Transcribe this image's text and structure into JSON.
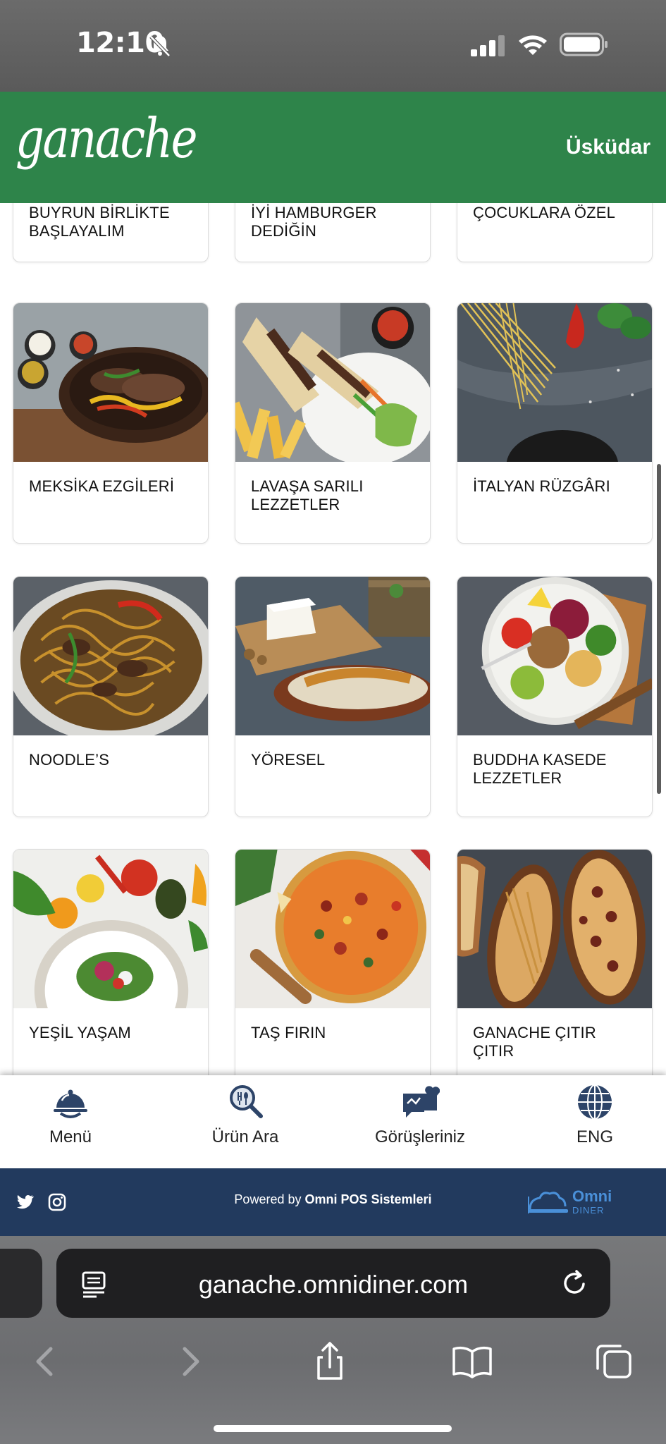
{
  "status_bar": {
    "time": "12:10"
  },
  "header": {
    "logo": "ganache",
    "branch": "Üsküdar"
  },
  "categories": [
    {
      "label": "BUYRUN BİRLİKTE\nBAŞLAYALIM"
    },
    {
      "label": "İYİ HAMBURGER\nDEDİĞİN"
    },
    {
      "label": "ÇOCUKLARA ÖZEL"
    },
    {
      "label": "MEKSİKA EZGİLERİ"
    },
    {
      "label": "LAVAŞA SARILI\nLEZZETLER"
    },
    {
      "label": "İTALYAN RÜZGÂRI"
    },
    {
      "label": "NOODLE’S"
    },
    {
      "label": "YÖRESEL"
    },
    {
      "label": "BUDDHA KASEDE\nLEZZETLER"
    },
    {
      "label": "YEŞİL YAŞAM"
    },
    {
      "label": "TAŞ FIRIN"
    },
    {
      "label": "GANACHE ÇITIR\nÇITIR"
    }
  ],
  "bottom_nav": {
    "menu": "Menü",
    "search": "Ürün Ara",
    "feedback": "Görüşleriniz",
    "language": "ENG"
  },
  "footer": {
    "powered_prefix": "Powered by",
    "powered_brand": "Omni POS Sistemleri",
    "omni_logo": "Omni",
    "omni_sub": "DINER"
  },
  "browser": {
    "url": "ganache.omnidiner.com"
  },
  "colors": {
    "header_green": "#2e844a",
    "footer_navy": "#223a5e",
    "nav_icon_navy": "#2d4468"
  },
  "icons": {
    "status": [
      "bell-slash-icon",
      "signal-icon",
      "wifi-icon",
      "battery-icon"
    ],
    "nav": [
      "cloche-icon",
      "search-icon",
      "feedback-icon",
      "globe-icon"
    ],
    "footer": [
      "twitter-icon",
      "instagram-icon"
    ],
    "browser": [
      "reader-icon",
      "reload-icon",
      "back-icon",
      "forward-icon",
      "share-icon",
      "bookmarks-icon",
      "tabs-icon"
    ]
  }
}
